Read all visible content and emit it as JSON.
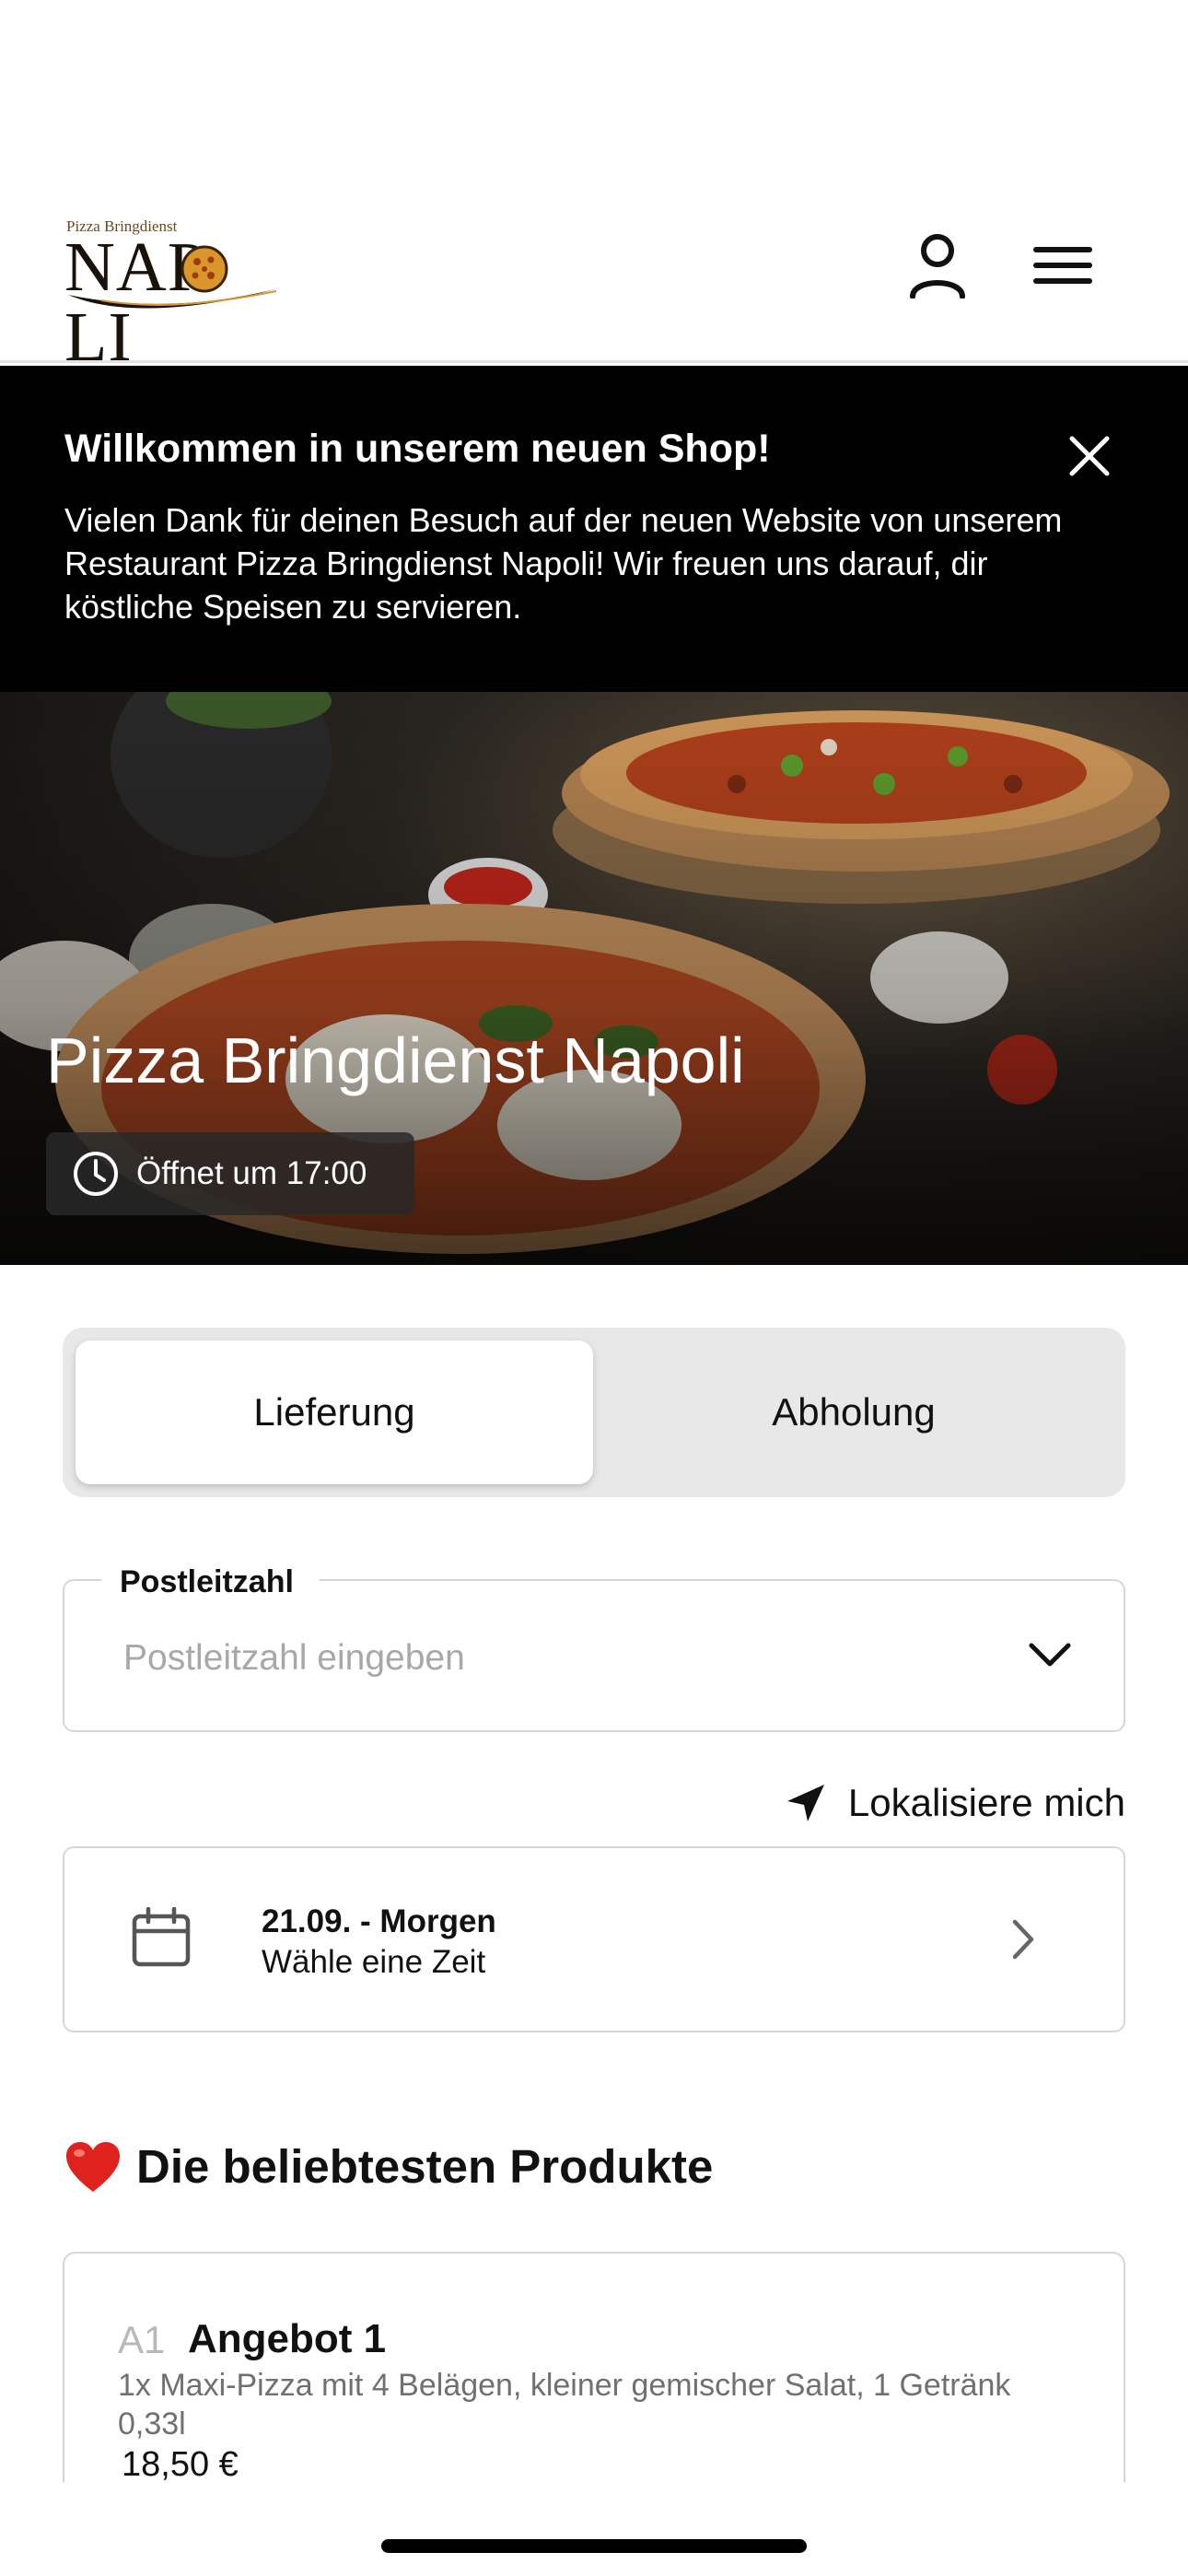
{
  "header": {
    "logo_small": "Pizza Bringdienst",
    "logo_big_1": "NAP",
    "logo_big_2": "LI",
    "user_icon": "user-icon",
    "menu_icon": "menu-icon"
  },
  "banner": {
    "title": "Willkommen in unserem neuen Shop!",
    "text": "Vielen Dank für deinen Besuch auf der neuen Website von unserem Restaurant Pizza Bringdienst Napoli! Wir freuen uns darauf, dir köstliche Speisen zu servieren.",
    "close_icon": "close-icon"
  },
  "hero": {
    "title": "Pizza Bringdienst Napoli",
    "hours": "Öffnet um 17:00",
    "clock_icon": "clock-icon"
  },
  "order_mode": {
    "options": [
      "Lieferung",
      "Abholung"
    ],
    "selected": "Lieferung"
  },
  "postcode": {
    "label": "Postleitzahl",
    "placeholder": "Postleitzahl eingeben",
    "value": ""
  },
  "locate": {
    "label": "Lokalisiere mich",
    "icon": "location-arrow-icon"
  },
  "schedule": {
    "date": "21.09. - Morgen",
    "hint": "Wähle eine Zeit",
    "icon": "calendar-icon"
  },
  "popular": {
    "emoji": "❤️",
    "title": "Die beliebtesten Produkte",
    "items": [
      {
        "code": "A1",
        "name": "Angebot 1",
        "description": "1x Maxi-Pizza mit 4 Belägen, kleiner gemischer Salat, 1 Getränk 0,33l",
        "price": "18,50 €"
      }
    ]
  },
  "colors": {
    "banner_bg": "#000000",
    "segment_bg": "#e8e8e8",
    "border": "#d6d6d6",
    "placeholder": "#a8a8a8",
    "text": "#111111"
  }
}
